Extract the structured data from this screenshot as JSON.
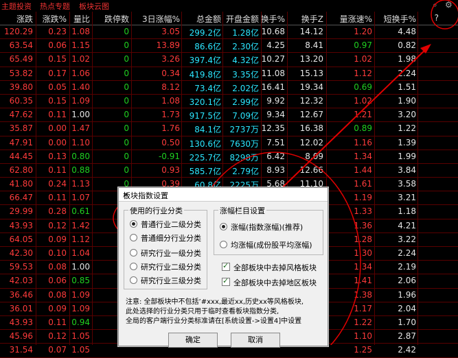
{
  "topbar": {
    "tabs": [
      "主题投资",
      "热点专题",
      "板块云图"
    ],
    "icons": [
      "search-icon",
      "gear-icon"
    ]
  },
  "header": [
    "涨跌",
    "涨跌%",
    "量比",
    "跌停数",
    "3日涨幅%",
    "总金额",
    "开盘金额",
    "换手%",
    "换手Z",
    "量涨速%",
    "短换手%",
    "?"
  ],
  "rows": [
    [
      "120.29",
      "0.23",
      "1.08",
      "0",
      "3.05",
      "299.2亿",
      "1.28亿",
      "10.68",
      "14.12",
      "1.20",
      "4.48"
    ],
    [
      "63.54",
      "0.06",
      "1.15",
      "0",
      "13.89",
      "86.6亿",
      "2.30亿",
      "4.25",
      "8.41",
      "0.97",
      "0.82"
    ],
    [
      "65.49",
      "0.15",
      "1.02",
      "0",
      "3.26",
      "397.4亿",
      "4.32亿",
      "10.27",
      "13.20",
      "1.02",
      "1.98"
    ],
    [
      "53.82",
      "0.17",
      "1.06",
      "0",
      "0.34",
      "419.8亿",
      "3.35亿",
      "11.08",
      "15.13",
      "1.12",
      "2.24"
    ],
    [
      "39.80",
      "0.05",
      "1.40",
      "0",
      "8.12",
      "73.4亿",
      "2.02亿",
      "16.41",
      "19.34",
      "0.69",
      "1.51"
    ],
    [
      "60.35",
      "0.15",
      "1.09",
      "0",
      "1.08",
      "320.1亿",
      "2.99亿",
      "9.92",
      "12.32",
      "1.02",
      "1.90"
    ],
    [
      "47.62",
      "0.11",
      "1.00",
      "0",
      "1.73",
      "917.5亿",
      "7.09亿",
      "9.34",
      "12.67",
      "1.21",
      "3.20"
    ],
    [
      "35.87",
      "0.00",
      "1.47",
      "0",
      "1.76",
      "84.1亿",
      "2737万",
      "12.35",
      "16.38",
      "0.89",
      "1.22"
    ],
    [
      "47.91",
      "0.00",
      "1.10",
      "0",
      "0.50",
      "130.6亿",
      "7630万",
      "7.51",
      "12.02",
      "1.16",
      "1.39"
    ],
    [
      "44.45",
      "0.13",
      "0.80",
      "0",
      "-0.91",
      "225.7亿",
      "8298万",
      "6.42",
      "8.09",
      "1.34",
      "1.99"
    ],
    [
      "62.80",
      "0.11",
      "0.88",
      "0",
      "0.93",
      "585.7亿",
      "2.79亿",
      "8.93",
      "12.66",
      "1.44",
      "3.84"
    ],
    [
      "41.80",
      "0.24",
      "1.13",
      "0",
      "0.39",
      "60.8亿",
      "2225万",
      "5.68",
      "11.10",
      "1.61",
      "3.58"
    ],
    [
      "66.47",
      "0.11",
      "1.07",
      "",
      "",
      "",
      "",
      "",
      "",
      "1.19",
      "3.21"
    ],
    [
      "29.99",
      "0.28",
      "0.61",
      "",
      "",
      "",
      "",
      "",
      "",
      "1.33",
      "1.18"
    ],
    [
      "43.93",
      "0.12",
      "1.42",
      "",
      "",
      "",
      "",
      "",
      "",
      "1.36",
      "4.21"
    ],
    [
      "64.05",
      "0.09",
      "1.12",
      "",
      "",
      "",
      "",
      "",
      "",
      "1.28",
      "3.22"
    ],
    [
      "42.30",
      "0.10",
      "1.04",
      "",
      "",
      "",
      "",
      "",
      "",
      "1.30",
      "2.24"
    ],
    [
      "59.53",
      "0.08",
      "1.00",
      "",
      "",
      "",
      "",
      "",
      "",
      "1.34",
      "2.19"
    ],
    [
      "42.03",
      "0.06",
      "0.85",
      "",
      "",
      "",
      "",
      "",
      "",
      "1.41",
      "2.06"
    ],
    [
      "36.46",
      "0.08",
      "1.09",
      "",
      "",
      "",
      "",
      "",
      "",
      "1.38",
      "1.96"
    ],
    [
      "36.01",
      "0.09",
      "1.09",
      "",
      "",
      "",
      "",
      "",
      "",
      "1.17",
      "2.04"
    ],
    [
      "43.93",
      "0.11",
      "0.94",
      "",
      "",
      "",
      "",
      "",
      "",
      "1.22",
      "1.70"
    ],
    [
      "45.96",
      "0.12",
      "1.05",
      "",
      "",
      "",
      "",
      "",
      "",
      "1.10",
      "2.87"
    ],
    [
      "31.54",
      "0.07",
      "1.05",
      "",
      "",
      "",
      "",
      "",
      "",
      "1.25",
      "2.42"
    ]
  ],
  "dialog": {
    "title": "板块指数设置",
    "close": "×",
    "group_left": {
      "title": "使用的行业分类",
      "options": [
        {
          "label": "普通行业二级分类",
          "selected": true
        },
        {
          "label": "普通细分行业分类",
          "selected": false
        },
        {
          "label": "研究行业一级分类",
          "selected": false
        },
        {
          "label": "研究行业二级分类",
          "selected": false
        },
        {
          "label": "研究行业三级分类",
          "selected": false
        }
      ]
    },
    "group_right": {
      "title": "涨幅栏目设置",
      "options": [
        {
          "label": "涨幅(指数涨幅)(推荐)",
          "selected": true
        },
        {
          "label": "均涨幅(成份股平均涨幅)",
          "selected": false
        }
      ]
    },
    "checkboxes": [
      {
        "label": "全部板块中去掉风格板块",
        "checked": true
      },
      {
        "label": "全部板块中去掉地区板块",
        "checked": true
      }
    ],
    "note_lines": [
      "注意: 全部板块中不包括’#xxx,最近xx,历史xx等风格板块,",
      "此处选择的行业分类只用于临时查看板块指数分类,",
      "全局的客户端行业分类标准请在[系统设置->设置4]中设置"
    ],
    "ok_label": "确定",
    "cancel_label": "取消"
  },
  "colors": {
    "annotation": "#e00000"
  }
}
